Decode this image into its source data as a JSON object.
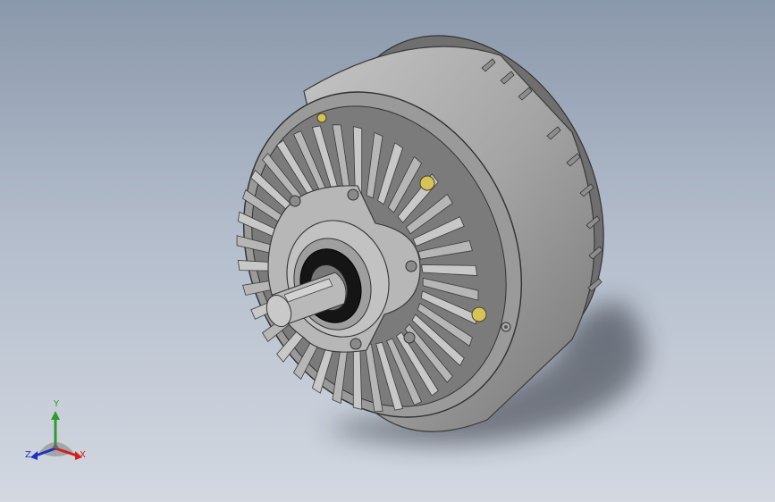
{
  "viewport": {
    "background_top": "#8a98ab",
    "background_bottom": "#d3d8e1"
  },
  "model": {
    "body_color": "#a3a3a3",
    "face_color": "#8c8c8c",
    "fin_color": "#b6b6b6",
    "bolt_color": "#d7c25a",
    "bearing_color": "#151515",
    "fin_count": 36
  },
  "triad": {
    "x_label": "X",
    "y_label": "Y",
    "z_label": "Z",
    "x_color": "#d02020",
    "y_color": "#2f9a2f",
    "z_color": "#2030c0"
  }
}
